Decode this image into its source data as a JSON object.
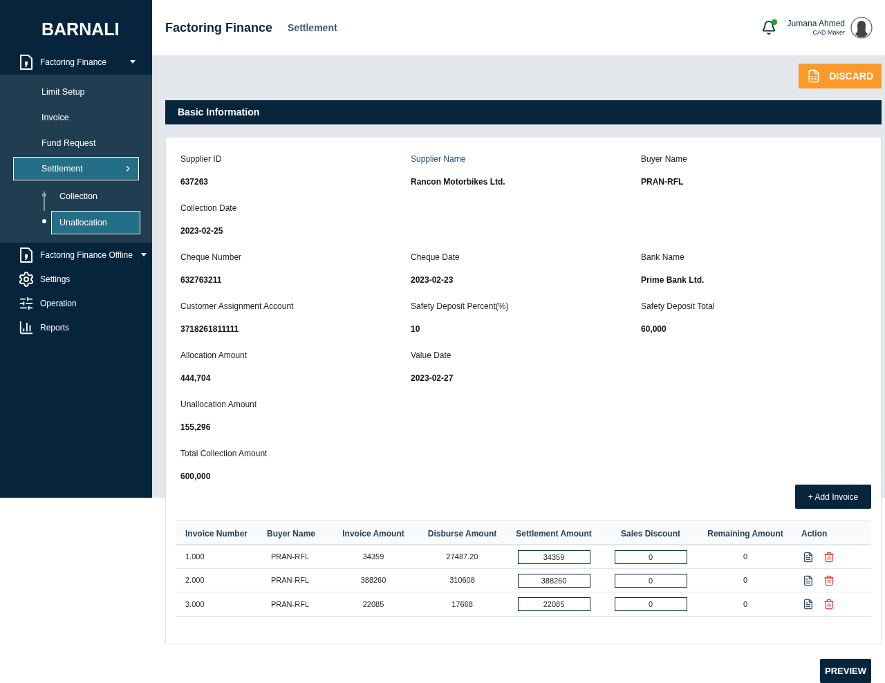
{
  "brand": "BARNALI",
  "sidebar": {
    "items": [
      {
        "label": "Factoring Finance",
        "kind": "menu",
        "expanded": true,
        "children": [
          {
            "label": "Limit Setup",
            "selected": false
          },
          {
            "label": "Invoice",
            "selected": false
          },
          {
            "label": "Fund Request",
            "selected": false
          },
          {
            "label": "Settlement",
            "selected": true,
            "children": [
              {
                "label": "Collection",
                "selected": false
              },
              {
                "label": "Unallocation",
                "selected": true
              }
            ]
          }
        ]
      },
      {
        "label": "Factoring Finance Offline",
        "kind": "menu"
      },
      {
        "label": "Settings",
        "kind": "settings"
      },
      {
        "label": "Operation",
        "kind": "operation"
      },
      {
        "label": "Reports",
        "kind": "reports"
      }
    ]
  },
  "header": {
    "title": "Factoring Finance",
    "breadcrumb": "Settlement",
    "user": {
      "name": "Jumana Ahmed",
      "role": "CAD Maker",
      "notification": true
    }
  },
  "discard_button": "DISCARD",
  "section_title": "Basic Information",
  "field_rows": [
    [
      {
        "label": "Supplier ID",
        "value": "637263",
        "highlighted": false
      },
      {
        "label": "Supplier Name",
        "value": "Rancon Motorbikes Ltd.",
        "highlighted": true
      },
      {
        "label": "Buyer Name",
        "value": "PRAN-RFL",
        "highlighted": false
      }
    ],
    [
      {
        "label": "Collection Date",
        "value": "2023-02-25",
        "highlighted": false
      }
    ],
    [
      {
        "label": "Cheque Number",
        "value": "632763211",
        "highlighted": false
      },
      {
        "label": "Cheque Date",
        "value": "2023-02-23",
        "highlighted": false
      },
      {
        "label": "Bank Name",
        "value": "Prime Bank Ltd.",
        "highlighted": false
      }
    ],
    [
      {
        "label": "Customer Assignment Account",
        "value": "3718261811111",
        "highlighted": false
      },
      {
        "label": "Safety Deposit Percent(%)",
        "value": "10",
        "highlighted": false
      },
      {
        "label": "Safety Deposit Total",
        "value": "60,000",
        "highlighted": false
      }
    ],
    [
      {
        "label": "Allocation Amount",
        "value": "444,704",
        "highlighted": false
      },
      {
        "label": "Value Date",
        "value": "2023-02-27",
        "highlighted": false
      }
    ],
    [
      {
        "label": "Unallocation Amount",
        "value": "155,296",
        "highlighted": false
      }
    ],
    [
      {
        "label": "Total Collection Amount",
        "value": "600,000",
        "highlighted": false
      }
    ]
  ],
  "add_invoice_button": "+ Add Invoice",
  "table": {
    "columns": [
      "Invoice Number",
      "Buyer Name",
      "Invoice Amount",
      "Disburse Amount",
      "Settlement Amount",
      "Sales Discount",
      "Remaining Amount",
      "Action"
    ],
    "rows": [
      {
        "invoice_number": "1.000",
        "buyer_name": "PRAN-RFL",
        "invoice_amount": "34359",
        "disburse_amount": "27487.20",
        "settlement_amount": "34359",
        "sales_discount": "0",
        "remaining_amount": "0"
      },
      {
        "invoice_number": "2.000",
        "buyer_name": "PRAN-RFL",
        "invoice_amount": "388260",
        "disburse_amount": "310608",
        "settlement_amount": "388260",
        "sales_discount": "0",
        "remaining_amount": "0"
      },
      {
        "invoice_number": "3.000",
        "buyer_name": "PRAN-RFL",
        "invoice_amount": "22085",
        "disburse_amount": "17668",
        "settlement_amount": "22085",
        "sales_discount": "0",
        "remaining_amount": "0"
      }
    ]
  },
  "preview_button": "PREVIEW"
}
